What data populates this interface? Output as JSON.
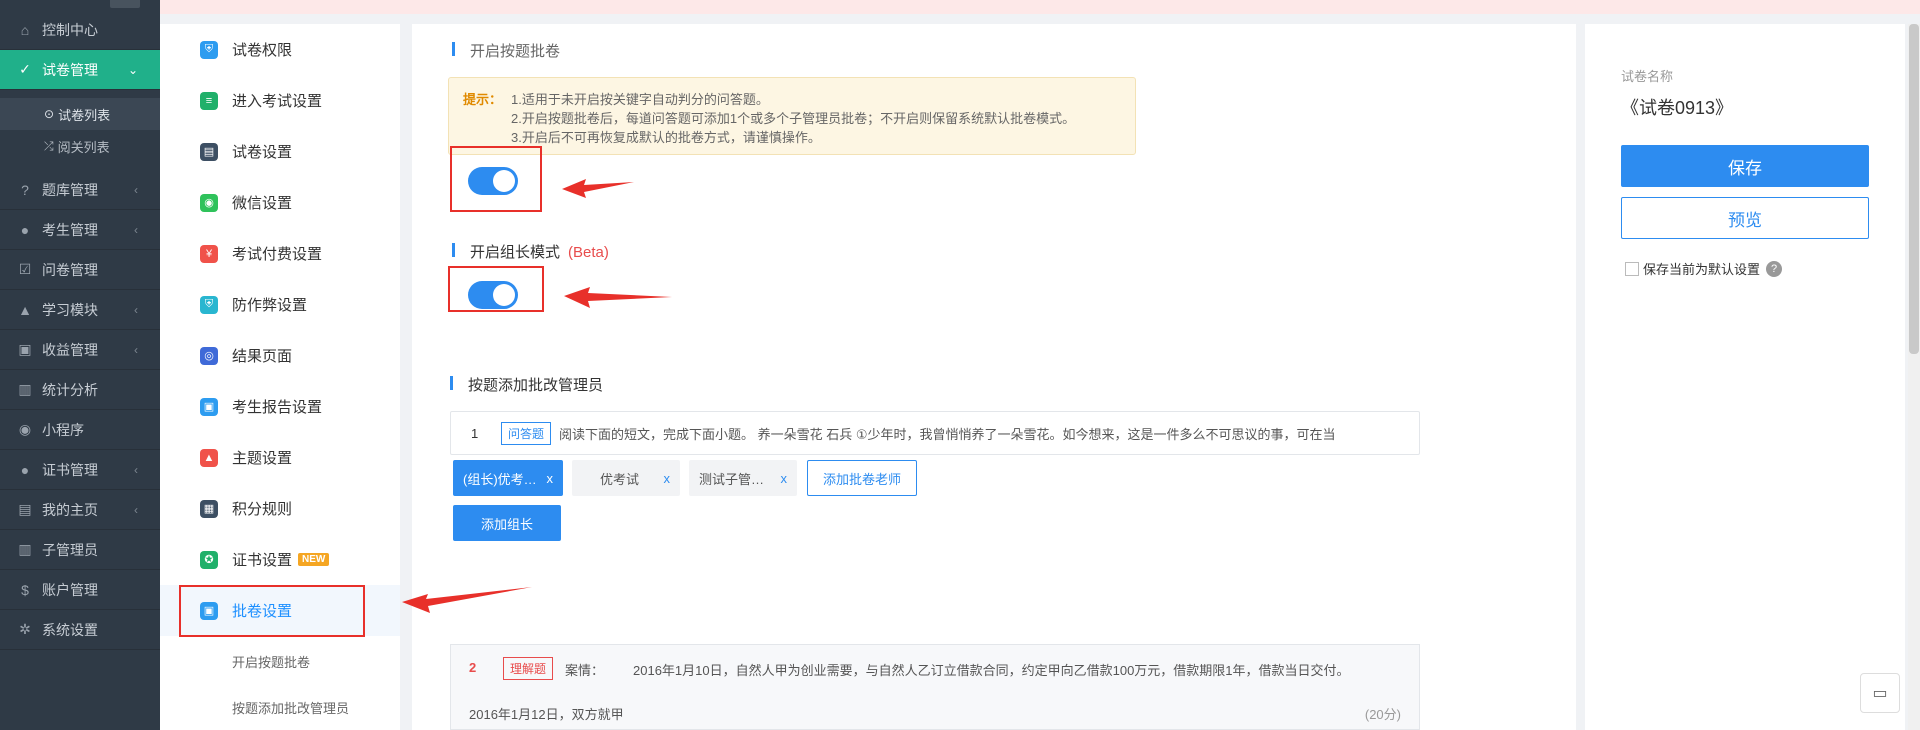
{
  "nav": {
    "items": [
      {
        "label": "控制中心",
        "icon": "home-icon",
        "glyph": "⌂"
      },
      {
        "label": "试卷管理",
        "icon": "check-circle-icon",
        "glyph": "✓"
      },
      {
        "label": "题库管理",
        "icon": "question-circle-icon",
        "glyph": "?"
      },
      {
        "label": "考生管理",
        "icon": "user-icon",
        "glyph": "●"
      },
      {
        "label": "问卷管理",
        "icon": "checkbox-icon",
        "glyph": "☑"
      },
      {
        "label": "学习模块",
        "icon": "graduation-cap-icon",
        "glyph": "▲"
      },
      {
        "label": "收益管理",
        "icon": "money-icon",
        "glyph": "▣"
      },
      {
        "label": "统计分析",
        "icon": "bar-chart-icon",
        "glyph": "▥"
      },
      {
        "label": "小程序",
        "icon": "wechat-icon",
        "glyph": "◉"
      },
      {
        "label": "证书管理",
        "icon": "certificate-icon",
        "glyph": "●"
      },
      {
        "label": "我的主页",
        "icon": "bank-icon",
        "glyph": "▤"
      },
      {
        "label": "子管理员",
        "icon": "lock-icon",
        "glyph": "▥"
      },
      {
        "label": "账户管理",
        "icon": "dollar-icon",
        "glyph": "$"
      },
      {
        "label": "系统设置",
        "icon": "gear-icon",
        "glyph": "✲"
      }
    ],
    "subs": [
      {
        "label": "试卷列表",
        "glyph": "⊙"
      },
      {
        "label": "阅关列表",
        "glyph": "⤮"
      }
    ]
  },
  "settings_menu": {
    "items": [
      {
        "label": "试卷权限",
        "color": "#2d9cf0",
        "glyph": "⛨"
      },
      {
        "label": "进入考试设置",
        "color": "#20b06a",
        "glyph": "≡"
      },
      {
        "label": "试卷设置",
        "color": "#3d4f63",
        "glyph": "▤"
      },
      {
        "label": "微信设置",
        "color": "#2fc25b",
        "glyph": "◉"
      },
      {
        "label": "考试付费设置",
        "color": "#f0524a",
        "glyph": "¥"
      },
      {
        "label": "防作弊设置",
        "color": "#29b6d0",
        "glyph": "⛨"
      },
      {
        "label": "结果页面",
        "color": "#3f6ad8",
        "glyph": "◎"
      },
      {
        "label": "考生报告设置",
        "color": "#2d9cf0",
        "glyph": "▣"
      },
      {
        "label": "主题设置",
        "color": "#f0524a",
        "glyph": "▲"
      },
      {
        "label": "积分规则",
        "color": "#3d4f63",
        "glyph": "▦"
      },
      {
        "label": "证书设置",
        "color": "#20b06a",
        "glyph": "✪",
        "badge": "NEW"
      },
      {
        "label": "批卷设置",
        "color": "#2d9cf0",
        "glyph": "▣"
      }
    ],
    "subs": [
      "开启按题批卷",
      "按题添加批改管理员"
    ]
  },
  "main": {
    "section1_title": "开启按题批卷",
    "tip_label": "提示：",
    "tip_lines": [
      "1.适用于未开启按关键字自动判分的问答题。",
      "2.开启按题批卷后，每道问答题可添加1个或多个子管理员批卷；不开启则保留系统默认批卷模式。",
      "3.开启后不可再恢复成默认的批卷方式，请谨慎操作。"
    ],
    "section2_title": "开启组长模式",
    "section2_beta": "(Beta)",
    "toggle1_on": true,
    "toggle2_on": true,
    "section3_title": "按题添加批改管理员",
    "q1": {
      "num": "1",
      "tag": "问答题",
      "text": "阅读下面的短文，完成下面小题。 养一朵雪花 石兵 ①少年时，我曾悄悄养了一朵雪花。如今想来，这是一件多么不可思议的事，可在当"
    },
    "chips": [
      {
        "label": "(组长)优考…",
        "x": "x"
      },
      {
        "label": "优考试",
        "x": "x"
      },
      {
        "label": "测试子管…",
        "x": "x"
      }
    ],
    "add_teacher": "添加批卷老师",
    "add_leader": "添加组长",
    "q2": {
      "num": "2",
      "tag": "理解题",
      "label": "案情：",
      "text": "2016年1月10日，自然人甲为创业需要，与自然人乙订立借款合同，约定甲向乙借款100万元，借款期限1年，借款当日交付。",
      "line2": "2016年1月12日，双方就甲",
      "score": "(20分)"
    }
  },
  "right_panel": {
    "label": "试卷名称",
    "name": "《试卷0913》",
    "save": "保存",
    "preview": "预览",
    "default_check": "保存当前为默认设置",
    "help": "?"
  },
  "colors": {
    "accent": "#2d8cf0",
    "nav_active": "#20b08a",
    "nav_bg": "#2f3a46",
    "annotation_red": "#e8302a"
  }
}
